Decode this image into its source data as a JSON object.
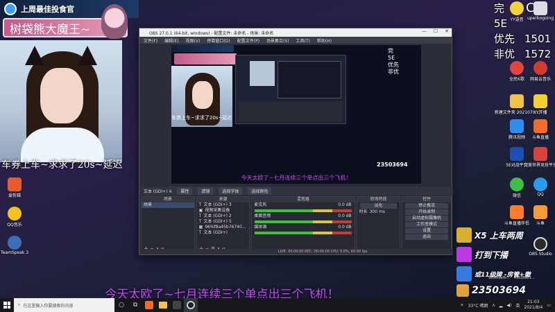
{
  "overlay": {
    "brand_text": "上周最佳投食官",
    "streamer_name": "树袋熊大魔王~",
    "cam_caption": "车券上车~求求了20s~延迟",
    "bottom_banner": "今天太欧了~七月连续三个单点出三个飞机！",
    "side_texts": [
      "完",
      "5E",
      "优先",
      "非优"
    ],
    "side_numbers": [
      "1501",
      "1572"
    ],
    "side_c": "C"
  },
  "obs": {
    "title": "OBS 27.0.1 (64-bit, windows) - 配置文件: 未命名 - 场景: 未命名",
    "window_buttons": [
      "—",
      "☐",
      "✕"
    ],
    "menu": [
      "文件(F)",
      "编辑(E)",
      "视图(V)",
      "停靠窗口(D)",
      "配置文件(P)",
      "场景集合(S)",
      "工具(T)",
      "帮助(H)"
    ],
    "source_bar": [
      "文本 (GDI+) 4",
      "属性",
      "滤镜",
      "选择字体",
      "选择颜色"
    ],
    "docks": {
      "scenes": "场景",
      "sources": "来源",
      "mixer": "混音器",
      "transitions": "转场特效",
      "controls": "控件"
    },
    "scene_item": "场景",
    "source_items": [
      "文本 (GDI+) 3",
      "视频采集设备",
      "文本 (GDI+) 2",
      "文本 (GDI+) 5",
      "96%f8a45b76740...",
      "文本 (GDI+)"
    ],
    "mixer_channels": [
      {
        "name": "麦克风",
        "db": "0.0 dB"
      },
      {
        "name": "桌面音频",
        "db": "0.0 dB"
      },
      {
        "name": "媒体源",
        "db": "0.0 dB"
      }
    ],
    "transition_type": "淡化",
    "transition_duration_label": "时长",
    "transition_duration": "300 ms",
    "control_buttons": [
      "停止推流",
      "开始录制",
      "启动虚拟摄像机",
      "工作室模式",
      "设置",
      "退出"
    ],
    "status": "LIVE: 00:00:00   REC: 00:00:00   CPU: 0.0%, 60.00 fps"
  },
  "desktop_icons_left": [
    {
      "label": "爱剪辑",
      "color": "#e85a2a"
    },
    {
      "label": "QQ音乐",
      "color": "#f3c21d"
    },
    {
      "label": "TeamSpeak 3",
      "color": "#3d6fb5"
    }
  ],
  "desktop_icons_right": [
    {
      "label": "YY语音",
      "color": "#f2d33c"
    },
    {
      "label": "uperbogoing",
      "color": "#dddddd"
    },
    {
      "label": "全民K歌",
      "color": "#e6453c"
    },
    {
      "label": "网易云音乐",
      "color": "#d33a31"
    },
    {
      "label": "新建文件夹 2021070...",
      "color": "#f0c24a"
    },
    {
      "label": "YY开播",
      "color": "#f3cf33"
    },
    {
      "label": "腾讯视频",
      "color": "#2f8df0"
    },
    {
      "label": "斗鱼直播",
      "color": "#f36b2a"
    },
    {
      "label": "5E对战平台",
      "color": "#1b4fb1"
    },
    {
      "label": "完美世界竞技平台",
      "color": "#d8423a"
    },
    {
      "label": "微信",
      "color": "#3dbf43"
    },
    {
      "label": "QQ",
      "color": "#2a9cf0"
    },
    {
      "label": "斗鱼直播伴侣",
      "color": "#ff7b2c"
    },
    {
      "label": "斗鱼",
      "color": "#f59a3a"
    }
  ],
  "awards": [
    {
      "text": "X5 上车两周",
      "color": "#d8b030"
    },
    {
      "text": "打到下播",
      "color": "#b83ae0"
    },
    {
      "text": "或11级牌 -房管+徽",
      "color": "#3a7ae0"
    },
    {
      "text": "23503694",
      "color": "#e0a23a"
    }
  ],
  "award_sub": [
    "9656f8efb...",
    "41828b01..."
  ],
  "obs_studio_label": "OBS Studio",
  "taskbar": {
    "search_placeholder": "在这里输入你要搜索的内容",
    "weather": "33°C 晴朗",
    "time": "21:03",
    "date": "2021/8/4",
    "lang": "英"
  }
}
